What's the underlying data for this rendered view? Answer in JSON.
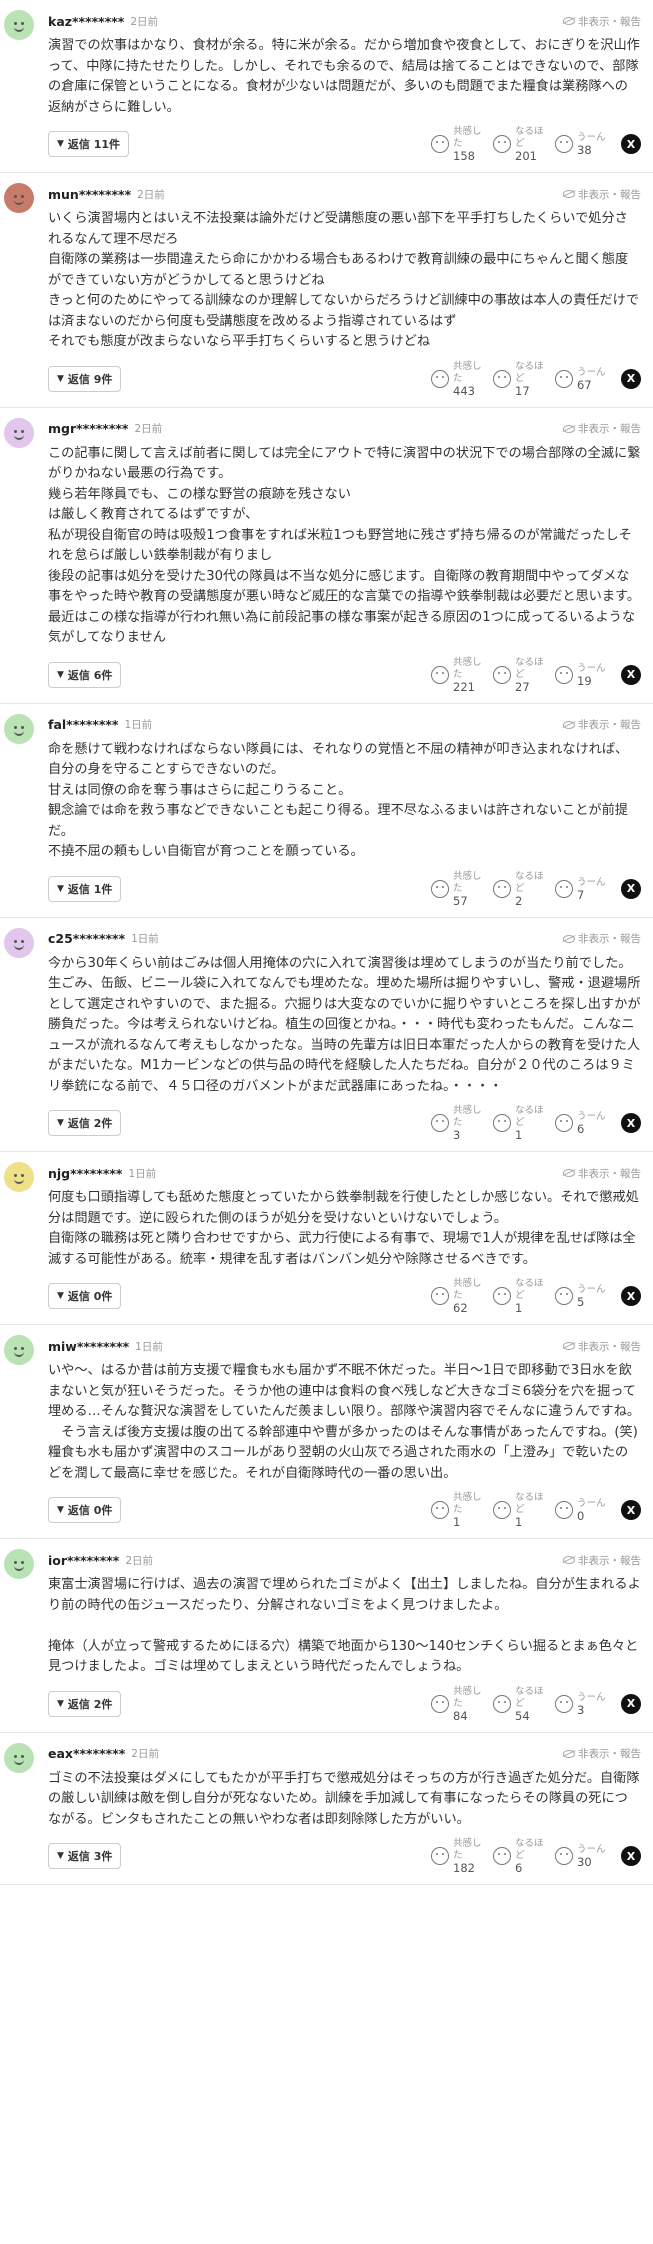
{
  "ui": {
    "hide_report": "非表示・報告",
    "reactions": [
      "共感した",
      "なるほど",
      "うーん"
    ],
    "share_icon": "X"
  },
  "comments": [
    {
      "user": "kaz********",
      "date": "2日前",
      "avatar_color": "#b9e3b5",
      "text": "演習での炊事はかなり、食材が余る。特に米が余る。だから増加食や夜食として、おにぎりを沢山作って、中隊に持たせたりした。しかし、それでも余るので、結局は捨てることはできないので、部隊の倉庫に保管ということになる。食材が少ないは問題だが、多いのも問題でまた糧食は業務隊への返納がさらに難しい。",
      "replies": "返信 11件",
      "counts": [
        "158",
        "201",
        "38"
      ]
    },
    {
      "user": "mun********",
      "date": "2日前",
      "avatar_color": "#c97b6a",
      "text": "いくら演習場内とはいえ不法投棄は論外だけど受講態度の悪い部下を平手打ちしたくらいで処分されるなんて理不尽だろ\n自衛隊の業務は一歩間違えたら命にかかわる場合もあるわけで教育訓練の最中にちゃんと聞く態度ができていない方がどうかしてると思うけどね\nきっと何のためにやってる訓練なのか理解してないからだろうけど訓練中の事故は本人の責任だけでは済まないのだから何度も受講態度を改めるよう指導されているはず\nそれでも態度が改まらないなら平手打ちくらいすると思うけどね",
      "replies": "返信 9件",
      "counts": [
        "443",
        "17",
        "67"
      ]
    },
    {
      "user": "mgr********",
      "date": "2日前",
      "avatar_color": "#e2c6ec",
      "text": "この記事に関して言えば前者に関しては完全にアウトで特に演習中の状況下での場合部隊の全滅に繋がりかねない最悪の行為です。\n幾ら若年隊員でも、この様な野営の痕跡を残さない\nは厳しく教育されてるはずですが、\n私が現役自衛官の時は吸殻1つ食事をすれば米粒1つも野営地に残さず持ち帰るのが常識だったしそれを怠らば厳しい鉄拳制裁が有りまし\n後段の記事は処分を受けた30代の隊員は不当な処分に感じます。自衛隊の教育期間中やってダメな事をやった時や教育の受講態度が悪い時など威圧的な言葉での指導や鉄拳制裁は必要だと思います。\n最近はこの様な指導が行われ無い為に前段記事の様な事案が起きる原因の1つに成ってるいるような気がしてなりません",
      "replies": "返信 6件",
      "counts": [
        "221",
        "27",
        "19"
      ]
    },
    {
      "user": "fal********",
      "date": "1日前",
      "avatar_color": "#b9e3b5",
      "text": "命を懸けて戦わなければならない隊員には、それなりの覚悟と不屈の精神が叩き込まれなければ、自分の身を守ることすらできないのだ。\n甘えは同僚の命を奪う事はさらに起こりうること。\n観念論では命を救う事などできないことも起こり得る。理不尽なふるまいは許されないことが前提だ。\n不撓不屈の頼もしい自衛官が育つことを願っている。",
      "replies": "返信 1件",
      "counts": [
        "57",
        "2",
        "7"
      ]
    },
    {
      "user": "c25********",
      "date": "1日前",
      "avatar_color": "#e2c6ec",
      "text": "今から30年くらい前はごみは個人用掩体の穴に入れて演習後は埋めてしまうのが当たり前でした。生ごみ、缶飯、ビニール袋に入れてなんでも埋めたな。埋めた場所は掘りやすいし、警戒・退避場所として選定されやすいので、また掘る。穴掘りは大変なのでいかに掘りやすいところを探し出すかが勝負だった。今は考えられないけどね。植生の回復とかね。・・・時代も変わったもんだ。こんなニュースが流れるなんて考えもしなかったな。当時の先輩方は旧日本軍だった人からの教育を受けた人がまだいたな。M1カービンなどの供与品の時代を経験した人たちだね。自分が２０代のころは９ミリ拳銃になる前で、４５口径のガバメントがまだ武器庫にあったね。・・・・",
      "replies": "返信 2件",
      "counts": [
        "3",
        "1",
        "6"
      ]
    },
    {
      "user": "njg********",
      "date": "1日前",
      "avatar_color": "#efe08a",
      "text": "何度も口頭指導しても舐めた態度とっていたから鉄拳制裁を行使したとしか感じない。それで懲戒処分は問題です。逆に殴られた側のほうが処分を受けないといけないでしょう。\n自衛隊の職務は死と隣り合わせですから、武力行使による有事で、現場で1人が規律を乱せば隊は全滅する可能性がある。統率・規律を乱す者はバンバン処分や除隊させるべきです。",
      "replies": "返信 0件",
      "counts": [
        "62",
        "1",
        "5"
      ]
    },
    {
      "user": "miw********",
      "date": "1日前",
      "avatar_color": "#b9e3b5",
      "text": "いや～、はるか昔は前方支援で糧食も水も届かず不眠不休だった。半日～1日で即移動で3日水を飲まないと気が狂いそうだった。そうか他の連中は食料の食べ残しなど大きなゴミ6袋分を穴を掘って埋める…そんな贅沢な演習をしていたんだ羨ましい限り。部隊や演習内容でそんなに違うんですね。\n　そう言えば後方支援は腹の出てる幹部連中や曹が多かったのはそんな事情があったんですね。(笑)　糧食も水も届かず演習中のスコールがあり翌朝の火山灰でろ過された雨水の「上澄み」で乾いたのどを潤して最高に幸せを感じた。それが自衛隊時代の一番の思い出。",
      "replies": "返信 0件",
      "counts": [
        "1",
        "1",
        "0"
      ]
    },
    {
      "user": "ior********",
      "date": "2日前",
      "avatar_color": "#b9e3b5",
      "text": "東富士演習場に行けば、過去の演習で埋められたゴミがよく【出土】しましたね。自分が生まれるより前の時代の缶ジュースだったり、分解されないゴミをよく見つけましたよ。\n\n掩体（人が立って警戒するためにほる穴）構築で地面から130～140センチくらい掘るとまぁ色々と見つけましたよ。ゴミは埋めてしまえという時代だったんでしょうね。",
      "replies": "返信 2件",
      "counts": [
        "84",
        "54",
        "3"
      ]
    },
    {
      "user": "eax********",
      "date": "2日前",
      "avatar_color": "#b9e3b5",
      "text": "ゴミの不法投棄はダメにしてもたかが平手打ちで懲戒処分はそっちの方が行き過ぎた処分だ。自衛隊の厳しい訓練は敵を倒し自分が死なないため。訓練を手加減して有事になったらその隊員の死につながる。ビンタもされたことの無いやわな者は即刻除隊した方がいい。",
      "replies": "返信 3件",
      "counts": [
        "182",
        "6",
        "30"
      ]
    }
  ]
}
